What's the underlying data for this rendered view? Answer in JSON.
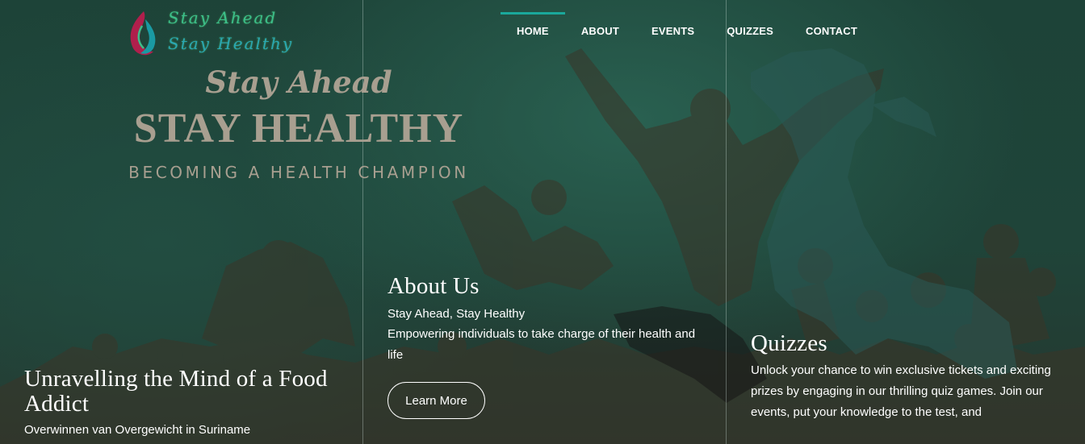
{
  "logo": {
    "line1": "Stay Ahead",
    "line2": "Stay Healthy"
  },
  "nav": {
    "items": [
      {
        "label": "HOME",
        "active": true
      },
      {
        "label": "ABOUT"
      },
      {
        "label": "EVENTS"
      },
      {
        "label": "QUIZZES"
      },
      {
        "label": "CONTACT"
      }
    ]
  },
  "hero": {
    "tagline_small": "Stay Ahead",
    "tagline_big": "STAY HEALTHY",
    "tagline_sub": "BECOMING A HEALTH CHAMPION"
  },
  "panels": {
    "left": {
      "title": "Unravelling the Mind of a Food Addict",
      "text": "Overwinnen van Overgewicht in Suriname"
    },
    "middle": {
      "title": "About Us",
      "line1": "Stay Ahead, Stay Healthy",
      "line2": "Empowering individuals to take charge of their health and life",
      "button": "Learn More"
    },
    "right": {
      "title": "Quizzes",
      "text": "Unlock your chance to win exclusive tickets and exciting prizes by engaging in our thrilling quiz games. Join our events, put your knowledge to the test, and"
    }
  },
  "colors": {
    "accent": "#1aa89b",
    "tagline": "#a89f90",
    "background": "#1f4439"
  }
}
